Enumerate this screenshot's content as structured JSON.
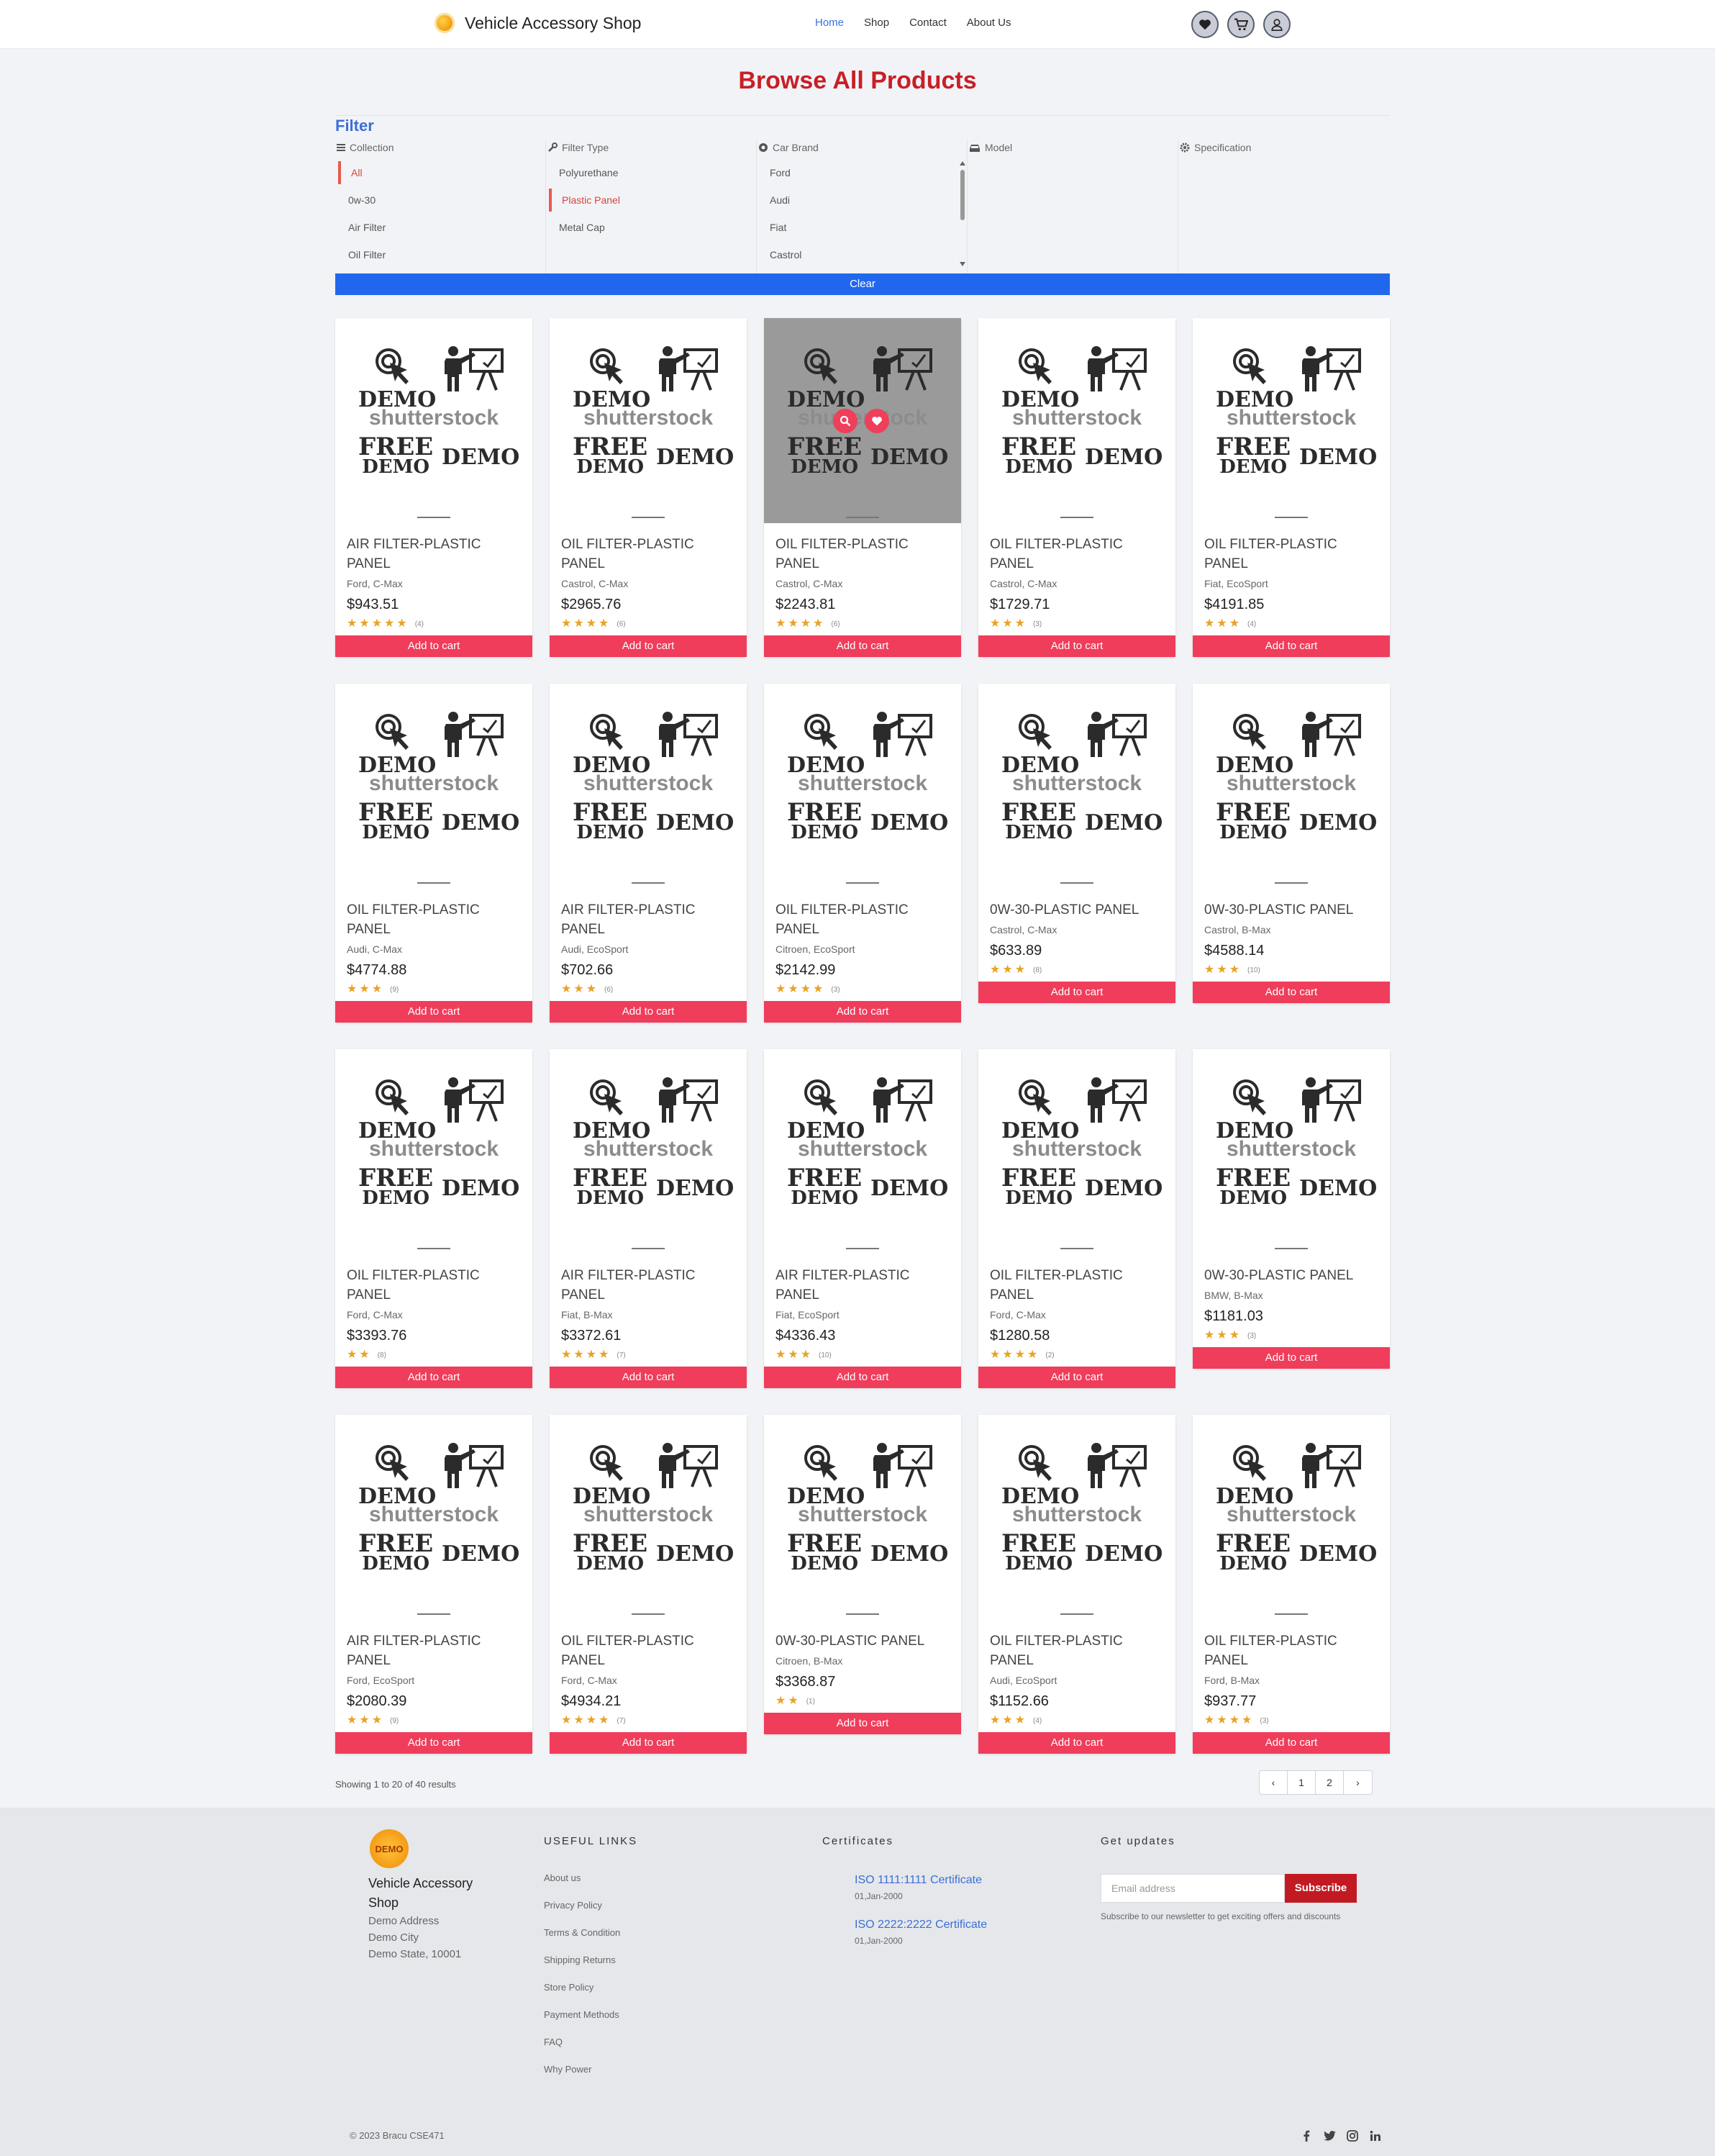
{
  "header": {
    "brand": "Vehicle Accessory Shop",
    "nav": [
      "Home",
      "Shop",
      "Contact",
      "About Us"
    ],
    "active_nav": "Home",
    "icons": [
      "heart-icon",
      "cart-icon",
      "user-icon"
    ]
  },
  "page_title": "Browse All Products",
  "filter": {
    "heading": "Filter",
    "collection": {
      "label": "Collection",
      "options": [
        "All",
        "0w-30",
        "Air Filter",
        "Oil Filter"
      ],
      "selected": "All"
    },
    "filter_type": {
      "label": "Filter Type",
      "options": [
        "Polyurethane",
        "Plastic Panel",
        "Metal Cap"
      ],
      "selected": "Plastic Panel"
    },
    "car_brand": {
      "label": "Car Brand",
      "options": [
        "Ford",
        "Audi",
        "Fiat",
        "Castrol"
      ]
    },
    "model": {
      "label": "Model"
    },
    "specification": {
      "label": "Specification"
    },
    "clear_label": "Clear"
  },
  "placeholder": {
    "demo": "DEMO",
    "brand": "shutterstock",
    "free": "FREE",
    "free_sub": "DEMO"
  },
  "products": [
    {
      "name": "AIR FILTER-PLASTIC PANEL",
      "sub": "Ford, C-Max",
      "price": "$943.51",
      "rating": 5,
      "count": "(4)"
    },
    {
      "name": "OIL FILTER-PLASTIC PANEL",
      "sub": "Castrol, C-Max",
      "price": "$2965.76",
      "rating": 4,
      "count": "(6)"
    },
    {
      "name": "OIL FILTER-PLASTIC PANEL",
      "sub": "Castrol, C-Max",
      "price": "$2243.81",
      "rating": 4,
      "count": "(6)"
    },
    {
      "name": "OIL FILTER-PLASTIC PANEL",
      "sub": "Castrol, C-Max",
      "price": "$1729.71",
      "rating": 3,
      "count": "(3)"
    },
    {
      "name": "OIL FILTER-PLASTIC PANEL",
      "sub": "Fiat, EcoSport",
      "price": "$4191.85",
      "rating": 3,
      "count": "(4)"
    },
    {
      "name": "OIL FILTER-PLASTIC PANEL",
      "sub": "Audi, C-Max",
      "price": "$4774.88",
      "rating": 3,
      "count": "(9)"
    },
    {
      "name": "AIR FILTER-PLASTIC PANEL",
      "sub": "Audi, EcoSport",
      "price": "$702.66",
      "rating": 3,
      "count": "(6)"
    },
    {
      "name": "OIL FILTER-PLASTIC PANEL",
      "sub": "Citroen, EcoSport",
      "price": "$2142.99",
      "rating": 4,
      "count": "(3)"
    },
    {
      "name": "0W-30-PLASTIC PANEL",
      "sub": "Castrol, C-Max",
      "price": "$633.89",
      "rating": 3,
      "count": "(8)"
    },
    {
      "name": "0W-30-PLASTIC PANEL",
      "sub": "Castrol, B-Max",
      "price": "$4588.14",
      "rating": 3,
      "count": "(10)"
    },
    {
      "name": "OIL FILTER-PLASTIC PANEL",
      "sub": "Ford, C-Max",
      "price": "$3393.76",
      "rating": 2,
      "count": "(8)"
    },
    {
      "name": "AIR FILTER-PLASTIC PANEL",
      "sub": "Fiat, B-Max",
      "price": "$3372.61",
      "rating": 4,
      "count": "(7)"
    },
    {
      "name": "AIR FILTER-PLASTIC PANEL",
      "sub": "Fiat, EcoSport",
      "price": "$4336.43",
      "rating": 3,
      "count": "(10)"
    },
    {
      "name": "OIL FILTER-PLASTIC PANEL",
      "sub": "Ford, C-Max",
      "price": "$1280.58",
      "rating": 4,
      "count": "(2)"
    },
    {
      "name": "0W-30-PLASTIC PANEL",
      "sub": "BMW, B-Max",
      "price": "$1181.03",
      "rating": 3,
      "count": "(3)"
    },
    {
      "name": "AIR FILTER-PLASTIC PANEL",
      "sub": "Ford, EcoSport",
      "price": "$2080.39",
      "rating": 3,
      "count": "(9)"
    },
    {
      "name": "OIL FILTER-PLASTIC PANEL",
      "sub": "Ford, C-Max",
      "price": "$4934.21",
      "rating": 4,
      "count": "(7)"
    },
    {
      "name": "0W-30-PLASTIC PANEL",
      "sub": "Citroen, B-Max",
      "price": "$3368.87",
      "rating": 2,
      "count": "(1)"
    },
    {
      "name": "OIL FILTER-PLASTIC PANEL",
      "sub": "Audi, EcoSport",
      "price": "$1152.66",
      "rating": 3,
      "count": "(4)"
    },
    {
      "name": "OIL FILTER-PLASTIC PANEL",
      "sub": "Ford, B-Max",
      "price": "$937.77",
      "rating": 4,
      "count": "(3)"
    }
  ],
  "add_to_cart_label": "Add to cart",
  "results_text": "Showing 1 to 20 of 40 results",
  "pagination": {
    "prev": "‹",
    "pages": [
      "1",
      "2"
    ],
    "next": "›"
  },
  "footer": {
    "logo_text": "DEMO",
    "brand": "Vehicle Accessory Shop",
    "address": [
      "Demo Address",
      "Demo City",
      "Demo State, 10001"
    ],
    "useful_links_heading": "USEFUL LINKS",
    "useful_links": [
      "About us",
      "Privacy Policy",
      "Terms & Condition",
      "Shipping Returns",
      "Store Policy",
      "Payment Methods",
      "FAQ",
      "Why Power"
    ],
    "certificates_heading": "Certificates",
    "certificates": [
      {
        "name": "ISO 1111:1111 Certificate",
        "date": "01,Jan-2000"
      },
      {
        "name": "ISO 2222:2222 Certificate",
        "date": "01,Jan-2000"
      }
    ],
    "updates_heading": "Get updates",
    "email_placeholder": "Email address",
    "subscribe_label": "Subscribe",
    "subscribe_note": "Subscribe to our newsletter to get exciting offers and discounts",
    "copyright": "© 2023 Bracu CSE471",
    "socials": [
      "facebook-icon",
      "twitter-icon",
      "instagram-icon",
      "linkedin-icon"
    ]
  },
  "colors": {
    "brand_red": "#c71f27",
    "accent_blue": "#2167ee",
    "cart_pink": "#ef3d5b",
    "star": "#e8a325"
  }
}
